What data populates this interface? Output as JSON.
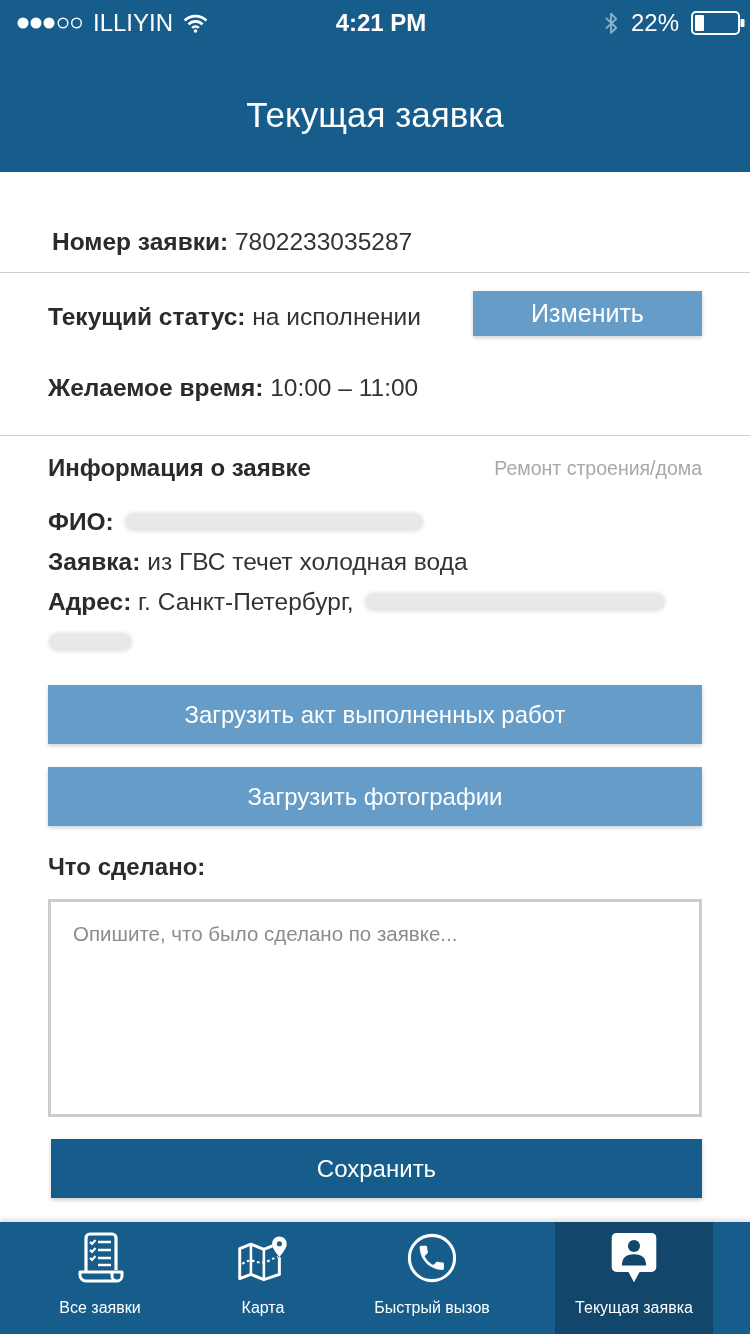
{
  "status_bar": {
    "carrier": "ILLIYIN",
    "time": "4:21 PM",
    "battery": "22%"
  },
  "header": {
    "title": "Текущая заявка"
  },
  "order_number": {
    "label": "Номер заявки:",
    "value": "7802233035287"
  },
  "status": {
    "label": "Текущий статус:",
    "value": "на исполнении",
    "button": "Изменить"
  },
  "desired_time": {
    "label": "Желаемое время:",
    "value": "10:00 – 11:00"
  },
  "info": {
    "title": "Информация о заявке",
    "category": "Ремонт строения/дома",
    "fields": [
      {
        "label": "ФИО:",
        "redacted": true
      },
      {
        "label": "Заявка:",
        "value": "из ГВС течет холодная вода",
        "redacted": false
      },
      {
        "label": "Адрес:",
        "value": "г. Санкт-Петербург,",
        "redacted": true
      }
    ]
  },
  "upload_buttons": [
    "Загрузить акт выполненных работ",
    "Загрузить фотографии"
  ],
  "work_done": {
    "label": "Что сделано:",
    "placeholder": "Опишите, что было сделано по заявке..."
  },
  "save_button": "Сохранить",
  "tab_bar": [
    {
      "label": "Все заявки",
      "selected": false
    },
    {
      "label": "Карта",
      "selected": false
    },
    {
      "label": "Быстрый вызов",
      "selected": false
    },
    {
      "label": "Текущая заявка",
      "selected": true
    }
  ]
}
